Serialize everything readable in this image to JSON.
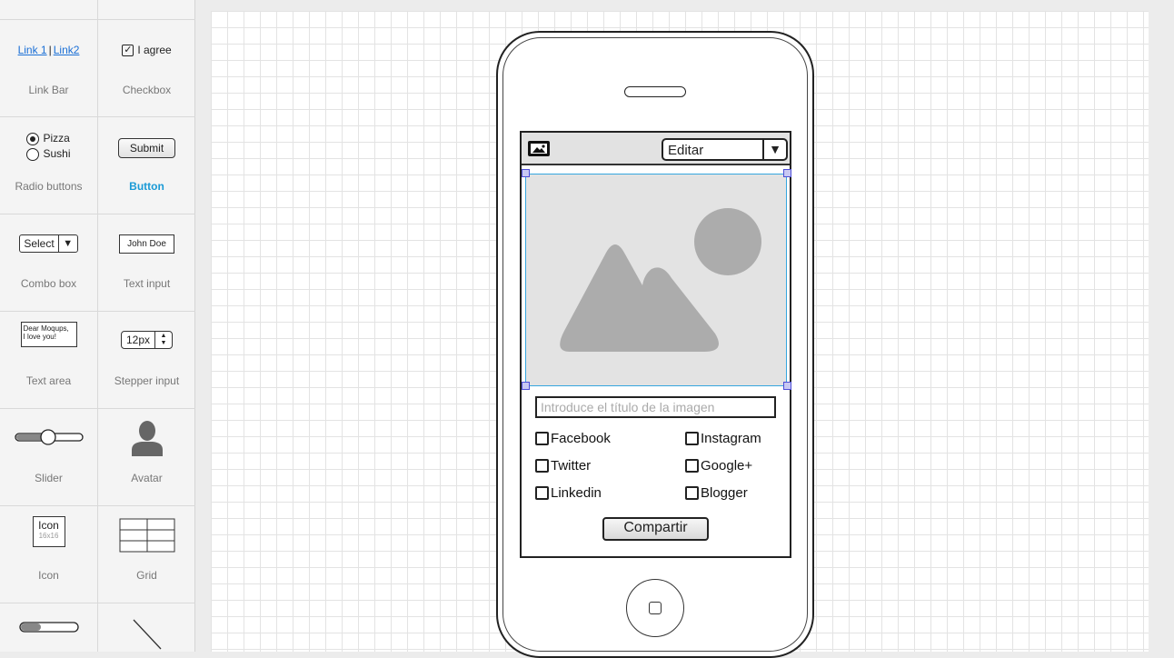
{
  "palette": {
    "linkbar": {
      "link1": "Link 1",
      "separator": "|",
      "link2": "Link2",
      "label": "Link Bar"
    },
    "checkbox": {
      "mark": "✓",
      "text": "I agree",
      "label": "Checkbox"
    },
    "radio": {
      "option1": "Pizza",
      "option2": "Sushi",
      "label": "Radio buttons"
    },
    "button": {
      "text": "Submit",
      "label": "Button"
    },
    "combo": {
      "text": "Select",
      "arrow": "▼",
      "label": "Combo box"
    },
    "textinput": {
      "text": "John Doe",
      "label": "Text input"
    },
    "textarea": {
      "line1": "Dear Moqups,",
      "line2": "I love you!",
      "label": "Text area"
    },
    "stepper": {
      "text": "12px",
      "up": "▲",
      "down": "▼",
      "label": "Stepper input"
    },
    "slider": {
      "label": "Slider"
    },
    "avatar": {
      "label": "Avatar"
    },
    "icon": {
      "text": "Icon",
      "sub": "16x16",
      "label": "Icon"
    },
    "grid": {
      "label": "Grid"
    }
  },
  "mockup": {
    "edit_select": {
      "value": "Editar",
      "arrow": "▼"
    },
    "title_input": {
      "placeholder": "Introduce el título de la imagen"
    },
    "share_options": [
      "Facebook",
      "Instagram",
      "Twitter",
      "Google+",
      "Linkedin",
      "Blogger"
    ],
    "share_button": "Compartir"
  },
  "colors": {
    "selection_blue": "#35a6df",
    "active_label": "#1a9ad6",
    "placeholder_fill": "#e3e3e3",
    "placeholder_shapes": "#acacac"
  }
}
